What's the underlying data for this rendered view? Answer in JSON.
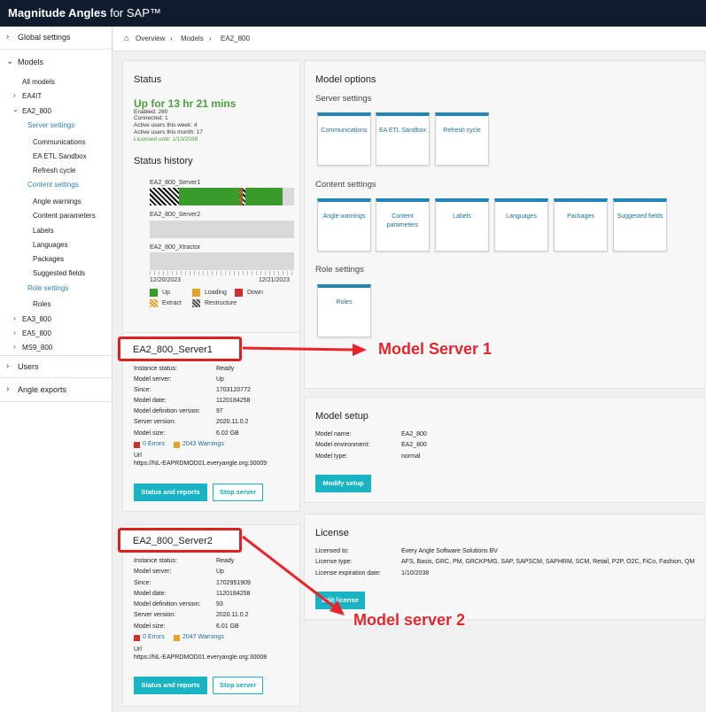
{
  "app": {
    "title_bold": "Magnitude Angles",
    "title_light": " for SAP™"
  },
  "sidebar": {
    "global_settings": "Global settings",
    "models": "Models",
    "all_models": "All models",
    "model_ea4it": "EA4IT",
    "model_ea2_800": "EA2_800",
    "server_settings": "Server settings",
    "communications": "Communications",
    "ea_etl_sandbox": "EA ETL Sandbox",
    "refresh_cycle": "Refresh cycle",
    "content_settings": "Content settings",
    "angle_warnings": "Angle warnings",
    "content_parameters": "Content parameters",
    "labels": "Labels",
    "languages": "Languages",
    "packages": "Packages",
    "suggested_fields": "Suggested fields",
    "role_settings": "Role settings",
    "roles": "Roles",
    "model_ea3_800": "EA3_800",
    "model_ea5_800": "EA5_800",
    "model_ms9_800": "MS9_800",
    "users": "Users",
    "angle_exports": "Angle exports"
  },
  "breadcrumb": {
    "overview": "Overview",
    "models": "Models",
    "current": "EA2_800"
  },
  "status": {
    "title": "Status",
    "uptime": "Up for 13 hr 21 mins",
    "enabled": "Enabled: 260",
    "connected": "Connected: 1",
    "active_week": "Active users this week: 4",
    "active_month": "Active users this month: 17",
    "licensed": "Licensed until: 1/10/2038",
    "history_title": "Status history",
    "servers": [
      "EA2_800_Server1",
      "EA2_800_Server2",
      "EA2_800_Xtractor"
    ],
    "date_start": "12/20/2023",
    "date_end": "12/21/2023",
    "legend": {
      "up": "Up",
      "loading": "Loading",
      "down": "Down",
      "extract": "Extract",
      "restructure": "Restructure"
    },
    "colors": {
      "up": "#3a9a2b",
      "loading": "#e8a12a",
      "down": "#d0302a"
    }
  },
  "server1": {
    "name": "EA2_800_Server1",
    "rows": [
      {
        "k": "Instance status:",
        "v": "Ready"
      },
      {
        "k": "Model server:",
        "v": "Up"
      },
      {
        "k": "Since:",
        "v": "1703120772"
      },
      {
        "k": "Model date:",
        "v": "1120184258"
      },
      {
        "k": "Model definition version:",
        "v": "97"
      },
      {
        "k": "Server version:",
        "v": "2020.11.0.2"
      },
      {
        "k": "Model size:",
        "v": "6.02 GB"
      }
    ],
    "errors": "0 Errors",
    "warnings": "2043 Warnings",
    "url_label": "Url",
    "url": "https://NL-EAPRDMOD01.everyangle.org:30009",
    "btn_status": "Status and reports",
    "btn_stop": "Stop server"
  },
  "server2": {
    "name": "EA2_800_Server2",
    "rows": [
      {
        "k": "Instance status:",
        "v": "Ready"
      },
      {
        "k": "Model server:",
        "v": "Up"
      },
      {
        "k": "Since:",
        "v": "1702951909"
      },
      {
        "k": "Model date:",
        "v": "1120184258"
      },
      {
        "k": "Model definition version:",
        "v": "93"
      },
      {
        "k": "Server version:",
        "v": "2020.11.0.2"
      },
      {
        "k": "Model size:",
        "v": "6.01 GB"
      }
    ],
    "errors": "0 Errors",
    "warnings": "2047 Warnings",
    "url_label": "Url",
    "url": "https://NL-EAPRDMOD01.everyangle.org:30008",
    "btn_status": "Status and reports",
    "btn_stop": "Stop server"
  },
  "model_options": {
    "title": "Model options",
    "server_settings": "Server settings",
    "server_cards": [
      "Communications",
      "EA ETL Sandbox",
      "Refresh cycle"
    ],
    "content_settings": "Content settings",
    "content_cards": [
      "Angle warnings",
      "Content parameters",
      "Labels",
      "Languages",
      "Packages",
      "Suggested fields"
    ],
    "role_settings": "Role settings",
    "role_cards": [
      "Roles"
    ]
  },
  "model_setup": {
    "title": "Model setup",
    "rows": [
      {
        "k": "Model name:",
        "v": "EA2_800"
      },
      {
        "k": "Model environment:",
        "v": "EA2_800"
      },
      {
        "k": "Model type:",
        "v": "normal"
      }
    ],
    "btn": "Modify setup"
  },
  "license": {
    "title": "License",
    "rows": [
      {
        "k": "Licensed to:",
        "v": "Every Angle Software Solutions BV"
      },
      {
        "k": "License type:",
        "v": "AFS, Basis, GRC, PM, GRCKPMG, SAP, SAPSCM, SAPHRM, SCM, Retail, P2P, O2C, FiCo, Fashion, QM"
      },
      {
        "k": "License expiration date:",
        "v": "1/10/2038"
      }
    ],
    "btn": "Edit license"
  },
  "annotations": {
    "a1": "Model Server 1",
    "a2": "Model server 2",
    "color": "#e8232a"
  }
}
